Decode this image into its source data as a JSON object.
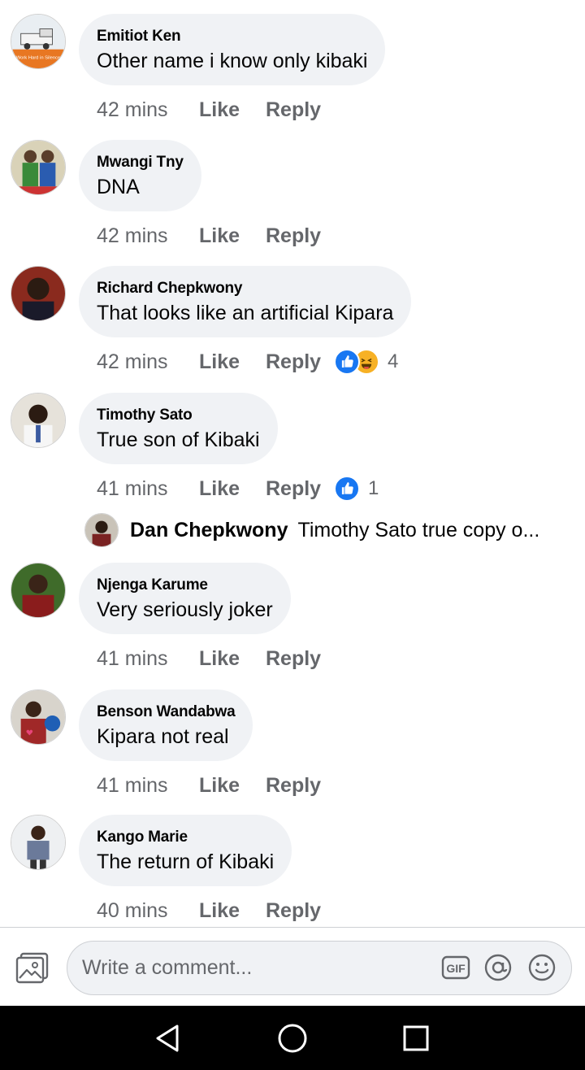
{
  "comments": [
    {
      "author": "Emitiot Ken",
      "text": "Other name i know only kibaki",
      "time": "42 mins",
      "like": "Like",
      "reply": "Reply",
      "avatar": "avatar-truck-icon"
    },
    {
      "author": "Mwangi Tny",
      "text": "DNA",
      "time": "42 mins",
      "like": "Like",
      "reply": "Reply",
      "avatar": "avatar-two-people-icon"
    },
    {
      "author": "Richard Chepkwony",
      "text": "That looks like an artificial Kipara",
      "time": "42 mins",
      "like": "Like",
      "reply": "Reply",
      "reaction_count": "4",
      "reactions": [
        "like",
        "haha"
      ]
    },
    {
      "author": "Timothy Sato",
      "text": "True son of Kibaki",
      "time": "41 mins",
      "like": "Like",
      "reply": "Reply",
      "reaction_count": "1",
      "reactions": [
        "like"
      ]
    },
    {
      "author": "Njenga Karume",
      "text": "Very seriously joker",
      "time": "41 mins",
      "like": "Like",
      "reply": "Reply"
    },
    {
      "author": "Benson Wandabwa",
      "text": "Kipara not real",
      "time": "41 mins",
      "like": "Like",
      "reply": "Reply"
    },
    {
      "author": "Kango Marie",
      "text": "The return of Kibaki",
      "time": "40 mins",
      "like": "Like",
      "reply": "Reply"
    }
  ],
  "nested_reply": {
    "author": "Dan Chepkwony",
    "text": "Timothy Sato true copy o..."
  },
  "avatar_badge_text": "Work Hard in Silence",
  "composer": {
    "placeholder": "Write a comment...",
    "gif_label": "GIF"
  },
  "colors": {
    "bubble": "#f0f2f5",
    "meta": "#65676b",
    "like_blue": "#1877f2",
    "haha_yellow": "#f7b125"
  }
}
